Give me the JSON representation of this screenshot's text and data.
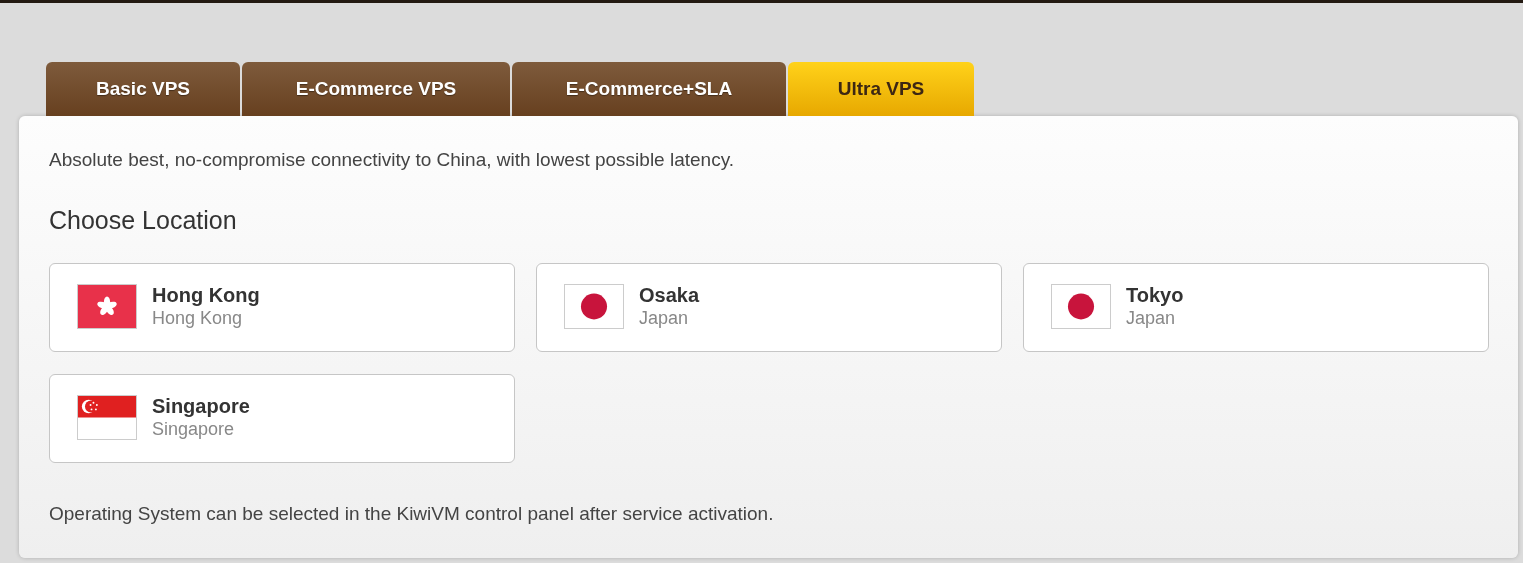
{
  "tabs": [
    {
      "label": "Basic VPS",
      "selected": false
    },
    {
      "label": "E-Commerce VPS",
      "selected": false
    },
    {
      "label": "E-Commerce+SLA",
      "selected": false
    },
    {
      "label": "Ultra VPS",
      "selected": true
    }
  ],
  "description": "Absolute best, no-compromise connectivity to China, with lowest possible latency.",
  "location_heading": "Choose Location",
  "locations": [
    {
      "kind": "hk",
      "name": "Hong Kong",
      "region": "Hong Kong"
    },
    {
      "kind": "jp",
      "name": "Osaka",
      "region": "Japan"
    },
    {
      "kind": "jp",
      "name": "Tokyo",
      "region": "Japan"
    },
    {
      "kind": "sg",
      "name": "Singapore",
      "region": "Singapore"
    }
  ],
  "note": "Operating System can be selected in the KiwiVM control panel after service activation."
}
